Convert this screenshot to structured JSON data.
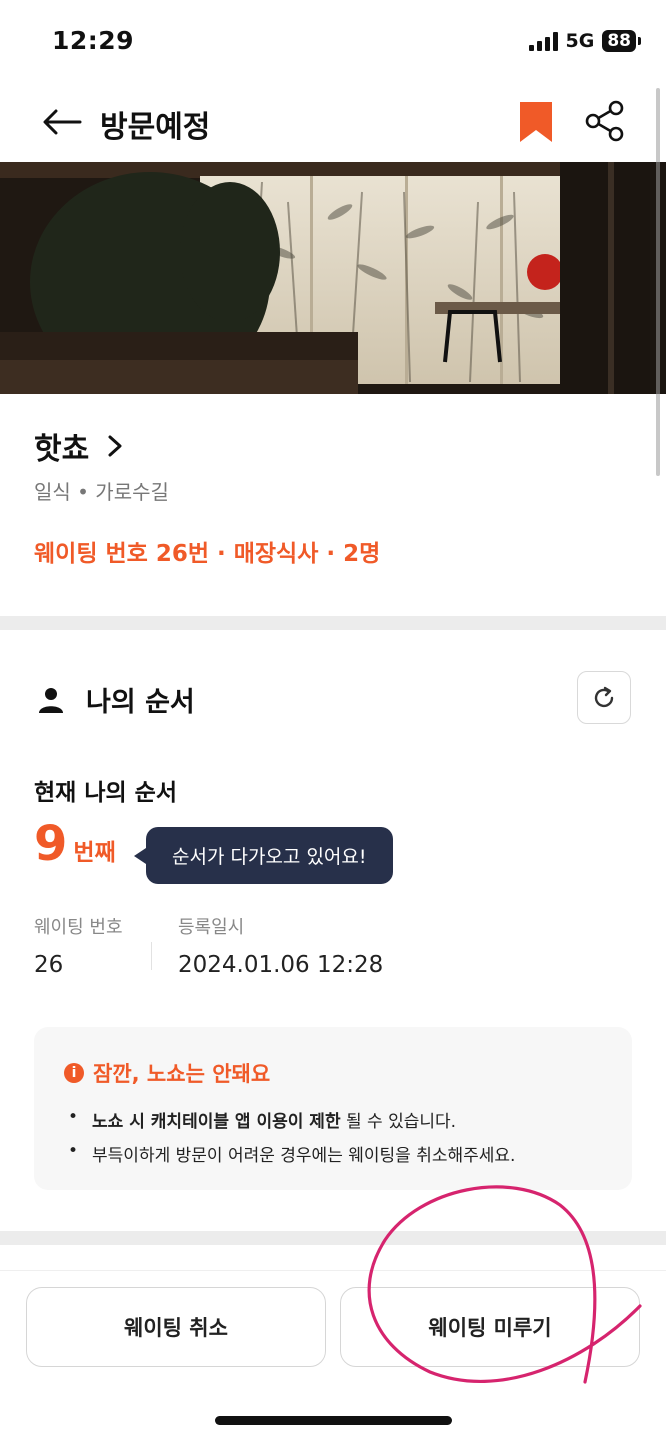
{
  "status_bar": {
    "time": "12:29",
    "network": "5G",
    "battery": "88"
  },
  "header": {
    "title": "방문예정"
  },
  "store": {
    "name": "핫쵸",
    "category_location": "일식 • 가로수길",
    "waiting_summary": "웨이팅 번호 26번 · 매장식사 · 2명"
  },
  "my_order": {
    "section_title": "나의 순서",
    "current_label": "현재 나의 순서",
    "order_number": "9",
    "order_unit": "번째",
    "tooltip": "순서가 다가오고 있어요!",
    "waiting_number_label": "웨이팅 번호",
    "waiting_number_value": "26",
    "registered_label": "등록일시",
    "registered_value": "2024.01.06 12:28"
  },
  "notice": {
    "title": "잠깐, 노쇼는 안돼요",
    "item1_bold": "노쇼 시 캐치테이블 앱 이용이 제한",
    "item1_rest": " 될 수 있습니다.",
    "item2": "부득이하게 방문이 어려운 경우에는 웨이팅을 취소해주세요."
  },
  "buttons": {
    "cancel": "웨이팅 취소",
    "postpone": "웨이팅 미루기"
  },
  "colors": {
    "accent": "#f05a28",
    "tooltip_bg": "#27304a",
    "annotation": "#d6246e"
  }
}
